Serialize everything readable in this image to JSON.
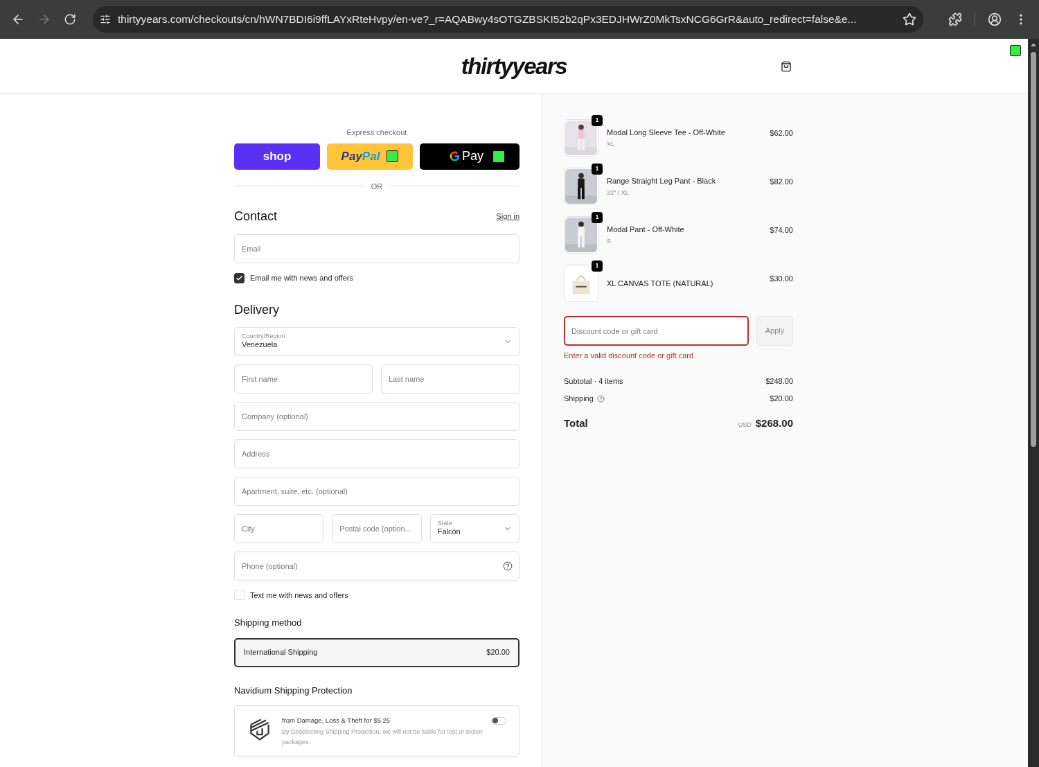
{
  "browser": {
    "url": "thirtyyears.com/checkouts/cn/hWN7BDI6i9ffLAYxRteHvpy/en-ve?_r=AQABwy4sOTGZBSKI52b2qPx3EDJHWrZ0MkTsxNCG6GrR&auto_redirect=false&e...",
    "forward_disabled": true
  },
  "header": {
    "logo": "thirtyyears"
  },
  "express_checkout": {
    "title": "Express checkout",
    "divider": "OR",
    "buttons": [
      {
        "kind": "shop",
        "label": "shop"
      },
      {
        "kind": "paypal",
        "label": "Pay",
        "label_2": "Pal"
      },
      {
        "kind": "gpay",
        "label": "Pay"
      }
    ]
  },
  "contact": {
    "title": "Contact",
    "sign_in": "Sign in",
    "email_placeholder": "Email",
    "newsletter": {
      "label": "Email me with news and offers",
      "checked": true
    }
  },
  "delivery": {
    "title": "Delivery",
    "rows": [
      [
        {
          "kind": "select",
          "label": "Country/Region",
          "value": "Venezuela"
        }
      ],
      [
        {
          "kind": "input",
          "placeholder": "First name"
        },
        {
          "kind": "input",
          "placeholder": "Last name"
        }
      ],
      [
        {
          "kind": "input",
          "placeholder": "Company (optional)"
        }
      ],
      [
        {
          "kind": "input",
          "placeholder": "Address"
        }
      ],
      [
        {
          "kind": "input",
          "placeholder": "Apartment, suite, etc. (optional)"
        }
      ],
      [
        {
          "kind": "input",
          "placeholder": "City"
        },
        {
          "kind": "input",
          "placeholder": "Postal code (option..."
        },
        {
          "kind": "select",
          "label": "State",
          "value": "Falcón"
        }
      ],
      [
        {
          "kind": "help",
          "placeholder": "Phone (optional)"
        }
      ]
    ],
    "sms": {
      "label": "Text me with news and offers",
      "checked": false
    }
  },
  "shipping_method": {
    "title": "Shipping method",
    "options": [
      {
        "label": "International Shipping",
        "price": "$20.00",
        "selected": true
      }
    ]
  },
  "protection": {
    "title": "Navidium Shipping Protection",
    "headline": "from Damage, Loss & Theft for $5.25",
    "note": "By Deselecting Shipping Protection, we will not be liable for lost or stolen packages.",
    "on": false
  },
  "summary": {
    "items": [
      {
        "name": "Modal Long Sleeve Tee - Off-White",
        "variant": "XL",
        "price": "$62.00",
        "quantity": "1",
        "kind": "tee"
      },
      {
        "name": "Range Straight Leg Pant - Black",
        "variant": "32\" / XL",
        "price": "$82.00",
        "quantity": "1",
        "kind": "black"
      },
      {
        "name": "Modal Pant - Off-White",
        "variant": "S",
        "price": "$74.00",
        "quantity": "1",
        "kind": "white"
      },
      {
        "name": "XL CANVAS TOTE (NATURAL)",
        "price": "$30.00",
        "quantity": "1",
        "kind": "tote"
      }
    ],
    "discount": {
      "placeholder": "Discount code or gift card",
      "button": "Apply",
      "error": "Enter a valid discount code or gift card"
    },
    "subtotal": {
      "label": "Subtotal · 4 items",
      "value": "$248.00"
    },
    "shipping": {
      "label": "Shipping",
      "value": "$20.00"
    },
    "total": {
      "label": "Total",
      "currency": "USD",
      "value": "$268.00"
    }
  }
}
